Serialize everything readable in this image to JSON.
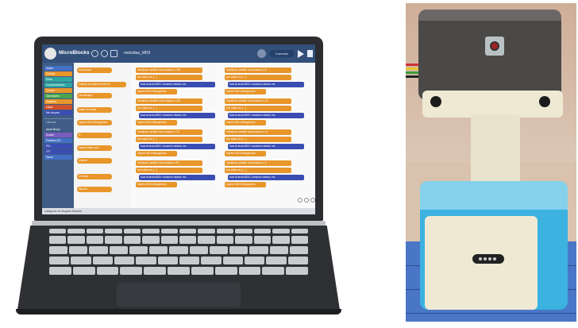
{
  "app": {
    "name": "MicroBlocks",
    "project_name": "melodias_MIDI",
    "board_label": "Conectar",
    "status_text": "Categoría de bloques   Sección"
  },
  "categories": [
    {
      "label": "Salida",
      "color": "#4470c4"
    },
    {
      "label": "Entrada",
      "color": "#e8962a"
    },
    {
      "label": "Pines",
      "color": "#2fa7a0"
    },
    {
      "label": "Comunicaciones",
      "color": "#2fa7a0"
    },
    {
      "label": "Control",
      "color": "#e8962a"
    },
    {
      "label": "Operadores",
      "color": "#4aa34e"
    },
    {
      "label": "Variables",
      "color": "#e8962a"
    },
    {
      "label": "Listas",
      "color": "#d2502c"
    },
    {
      "label": "Mis bloques",
      "color": "#3a4db2"
    }
  ],
  "libraries_label": "Librerías",
  "libraries": [
    {
      "label": "smart library",
      "color": "#3f5d86"
    },
    {
      "label": "Sonido",
      "color": "#7a5cc1"
    },
    {
      "label": "Pantalla LED",
      "color": "#4470c4"
    },
    {
      "label": "PIO",
      "color": "#3a4db2"
    },
    {
      "label": "TFT",
      "color": "#3a4db2"
    },
    {
      "label": "Tonos",
      "color": "#4470c4"
    }
  ],
  "palette_blocks": [
    {
      "label": "al empezar",
      "color": "#e8962a"
    },
    {
      "label": "cuando se pulse el botón A",
      "color": "#e8962a"
    },
    {
      "label": "por siempre",
      "color": "#e8962a"
    },
    {
      "label": "repite 10 veces",
      "color": "#e8962a"
    },
    {
      "label": "espera 500 milisegundos",
      "color": "#e8962a"
    },
    {
      "label": "si",
      "color": "#e8962a"
    },
    {
      "label": "espera hasta que",
      "color": "#e8962a"
    },
    {
      "label": "retorna",
      "color": "#e8962a"
    },
    {
      "label": "al recibir",
      "color": "#e8962a"
    },
    {
      "label": "difundir",
      "color": "#e8962a"
    }
  ],
  "script_columns": [
    [
      {
        "label": "inicializar variable local  retardo  a  250",
        "color": "#e8962a",
        "indent": 0
      },
      {
        "label": "por cada  i  en  [...]",
        "color": "#e8962a",
        "indent": 0
      },
      {
        "label": "toca la tecla MIDI  i  duración  retardo  ms",
        "color": "#3a4db2",
        "indent": 1
      },
      {
        "label": "espera  500  milisegundos",
        "color": "#e8962a",
        "indent": 0
      },
      {
        "label": "inicializar variable local  retardo  a  125",
        "color": "#e8962a",
        "indent": 0
      },
      {
        "label": "por cada  i  en  [...]",
        "color": "#e8962a",
        "indent": 0
      },
      {
        "label": "toca la tecla MIDI  i  duración  retardo  ms",
        "color": "#3a4db2",
        "indent": 1
      },
      {
        "label": "espera  500  milisegundos",
        "color": "#e8962a",
        "indent": 0
      },
      {
        "label": "inicializar variable local  retardo  a  75",
        "color": "#e8962a",
        "indent": 0
      },
      {
        "label": "por cada  i  en  [...]",
        "color": "#e8962a",
        "indent": 0
      },
      {
        "label": "toca la tecla MIDI  i  duración  retardo  ms",
        "color": "#3a4db2",
        "indent": 1
      },
      {
        "label": "espera  500  milisegundos",
        "color": "#e8962a",
        "indent": 0
      },
      {
        "label": "inicializar variable local  retardo  a  50",
        "color": "#e8962a",
        "indent": 0
      },
      {
        "label": "por cada  i  en  [...]",
        "color": "#e8962a",
        "indent": 0
      },
      {
        "label": "toca la tecla MIDI  i  duración  retardo  ms",
        "color": "#3a4db2",
        "indent": 1
      },
      {
        "label": "espera  500  milisegundos",
        "color": "#e8962a",
        "indent": 0
      }
    ],
    [
      {
        "label": "inicializar variable local  retardo  a  5",
        "color": "#e8962a",
        "indent": 0
      },
      {
        "label": "por cada  i  en  [...]",
        "color": "#e8962a",
        "indent": 0
      },
      {
        "label": "toca la tecla MIDI  i  duración  retardo  ms",
        "color": "#3a4db2",
        "indent": 1
      },
      {
        "label": "espera  500  milisegundos",
        "color": "#e8962a",
        "indent": 0
      },
      {
        "label": "inicializar variable local  retardo  a  20",
        "color": "#e8962a",
        "indent": 0
      },
      {
        "label": "por cada  i  en  [...]",
        "color": "#e8962a",
        "indent": 0
      },
      {
        "label": "toca la tecla MIDI  i  duración  retardo  ms",
        "color": "#3a4db2",
        "indent": 1
      },
      {
        "label": "espera  500  milisegundos",
        "color": "#e8962a",
        "indent": 0
      },
      {
        "label": "inicializar variable local  retardo  a  10",
        "color": "#e8962a",
        "indent": 0
      },
      {
        "label": "por cada  i  en  [...]",
        "color": "#e8962a",
        "indent": 0
      },
      {
        "label": "toca la tecla MIDI  i  duración  retardo  ms",
        "color": "#3a4db2",
        "indent": 1
      },
      {
        "label": "espera  500  milisegundos",
        "color": "#e8962a",
        "indent": 0
      },
      {
        "label": "inicializar variable local  retardo  a  5",
        "color": "#e8962a",
        "indent": 0
      },
      {
        "label": "por cada  i  en  [...]",
        "color": "#e8962a",
        "indent": 0
      },
      {
        "label": "toca la tecla MIDI  i  duración  retardo  ms",
        "color": "#3a4db2",
        "indent": 1
      },
      {
        "label": "espera  500  milisegundos",
        "color": "#e8962a",
        "indent": 0
      }
    ]
  ]
}
